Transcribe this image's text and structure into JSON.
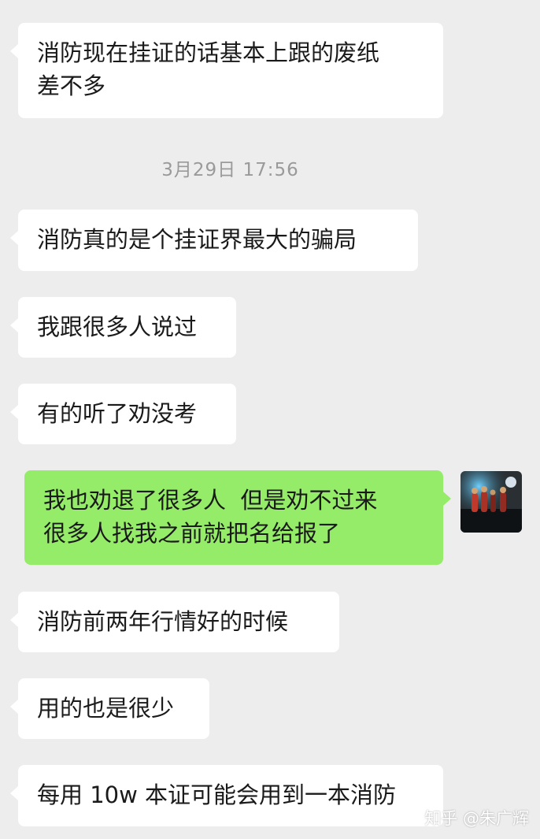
{
  "conversation": {
    "messages": [
      {
        "side": "in",
        "lines": [
          "消防现在挂证的话基本上跟的废纸",
          "差不多"
        ]
      },
      {
        "side": "in",
        "lines": [
          "消防真的是个挂证界最大的骗局"
        ]
      },
      {
        "side": "in",
        "lines": [
          "我跟很多人说过"
        ]
      },
      {
        "side": "in",
        "lines": [
          "有的听了劝没考"
        ]
      },
      {
        "side": "out",
        "lines": [
          "我也劝退了很多人  但是劝不过来",
          "很多人找我之前就把名给报了"
        ]
      },
      {
        "side": "in",
        "lines": [
          "消防前两年行情好的时候"
        ]
      },
      {
        "side": "in",
        "lines": [
          "用的也是很少"
        ]
      },
      {
        "side": "in",
        "lines": [
          "每用 10w 本证可能会用到一本消防"
        ]
      }
    ],
    "timestamp": "3月29日 17:56"
  },
  "watermark": "知乎 @朱广辉",
  "colors": {
    "background": "#ededed",
    "incoming_bubble": "#ffffff",
    "outgoing_bubble": "#95ec69",
    "timestamp_text": "#9a9a9a"
  },
  "icons": {
    "avatar": "user-avatar-photo"
  }
}
